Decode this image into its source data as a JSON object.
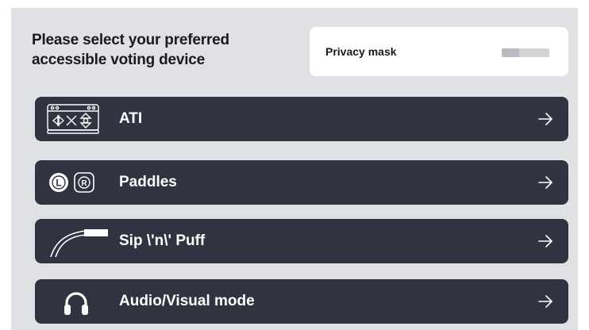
{
  "prompt": {
    "line1": "Please select your preferred",
    "line2": "accessible voting device"
  },
  "privacy": {
    "label": "Privacy mask",
    "enabled": false
  },
  "options": [
    {
      "label": "ATI",
      "icon": "ati-keypad-icon"
    },
    {
      "label": "Paddles",
      "icon": "paddles-icon"
    },
    {
      "label": "Sip \\'n\\' Puff",
      "icon": "sip-puff-tube-icon"
    },
    {
      "label": "Audio/Visual mode",
      "icon": "headphones-icon"
    }
  ],
  "arrow_icon": "arrow-right-icon",
  "colors": {
    "panel_background": "#dfe1e4",
    "option_background": "#2f3440",
    "option_text": "#ffffff",
    "card_background": "#ffffff"
  }
}
